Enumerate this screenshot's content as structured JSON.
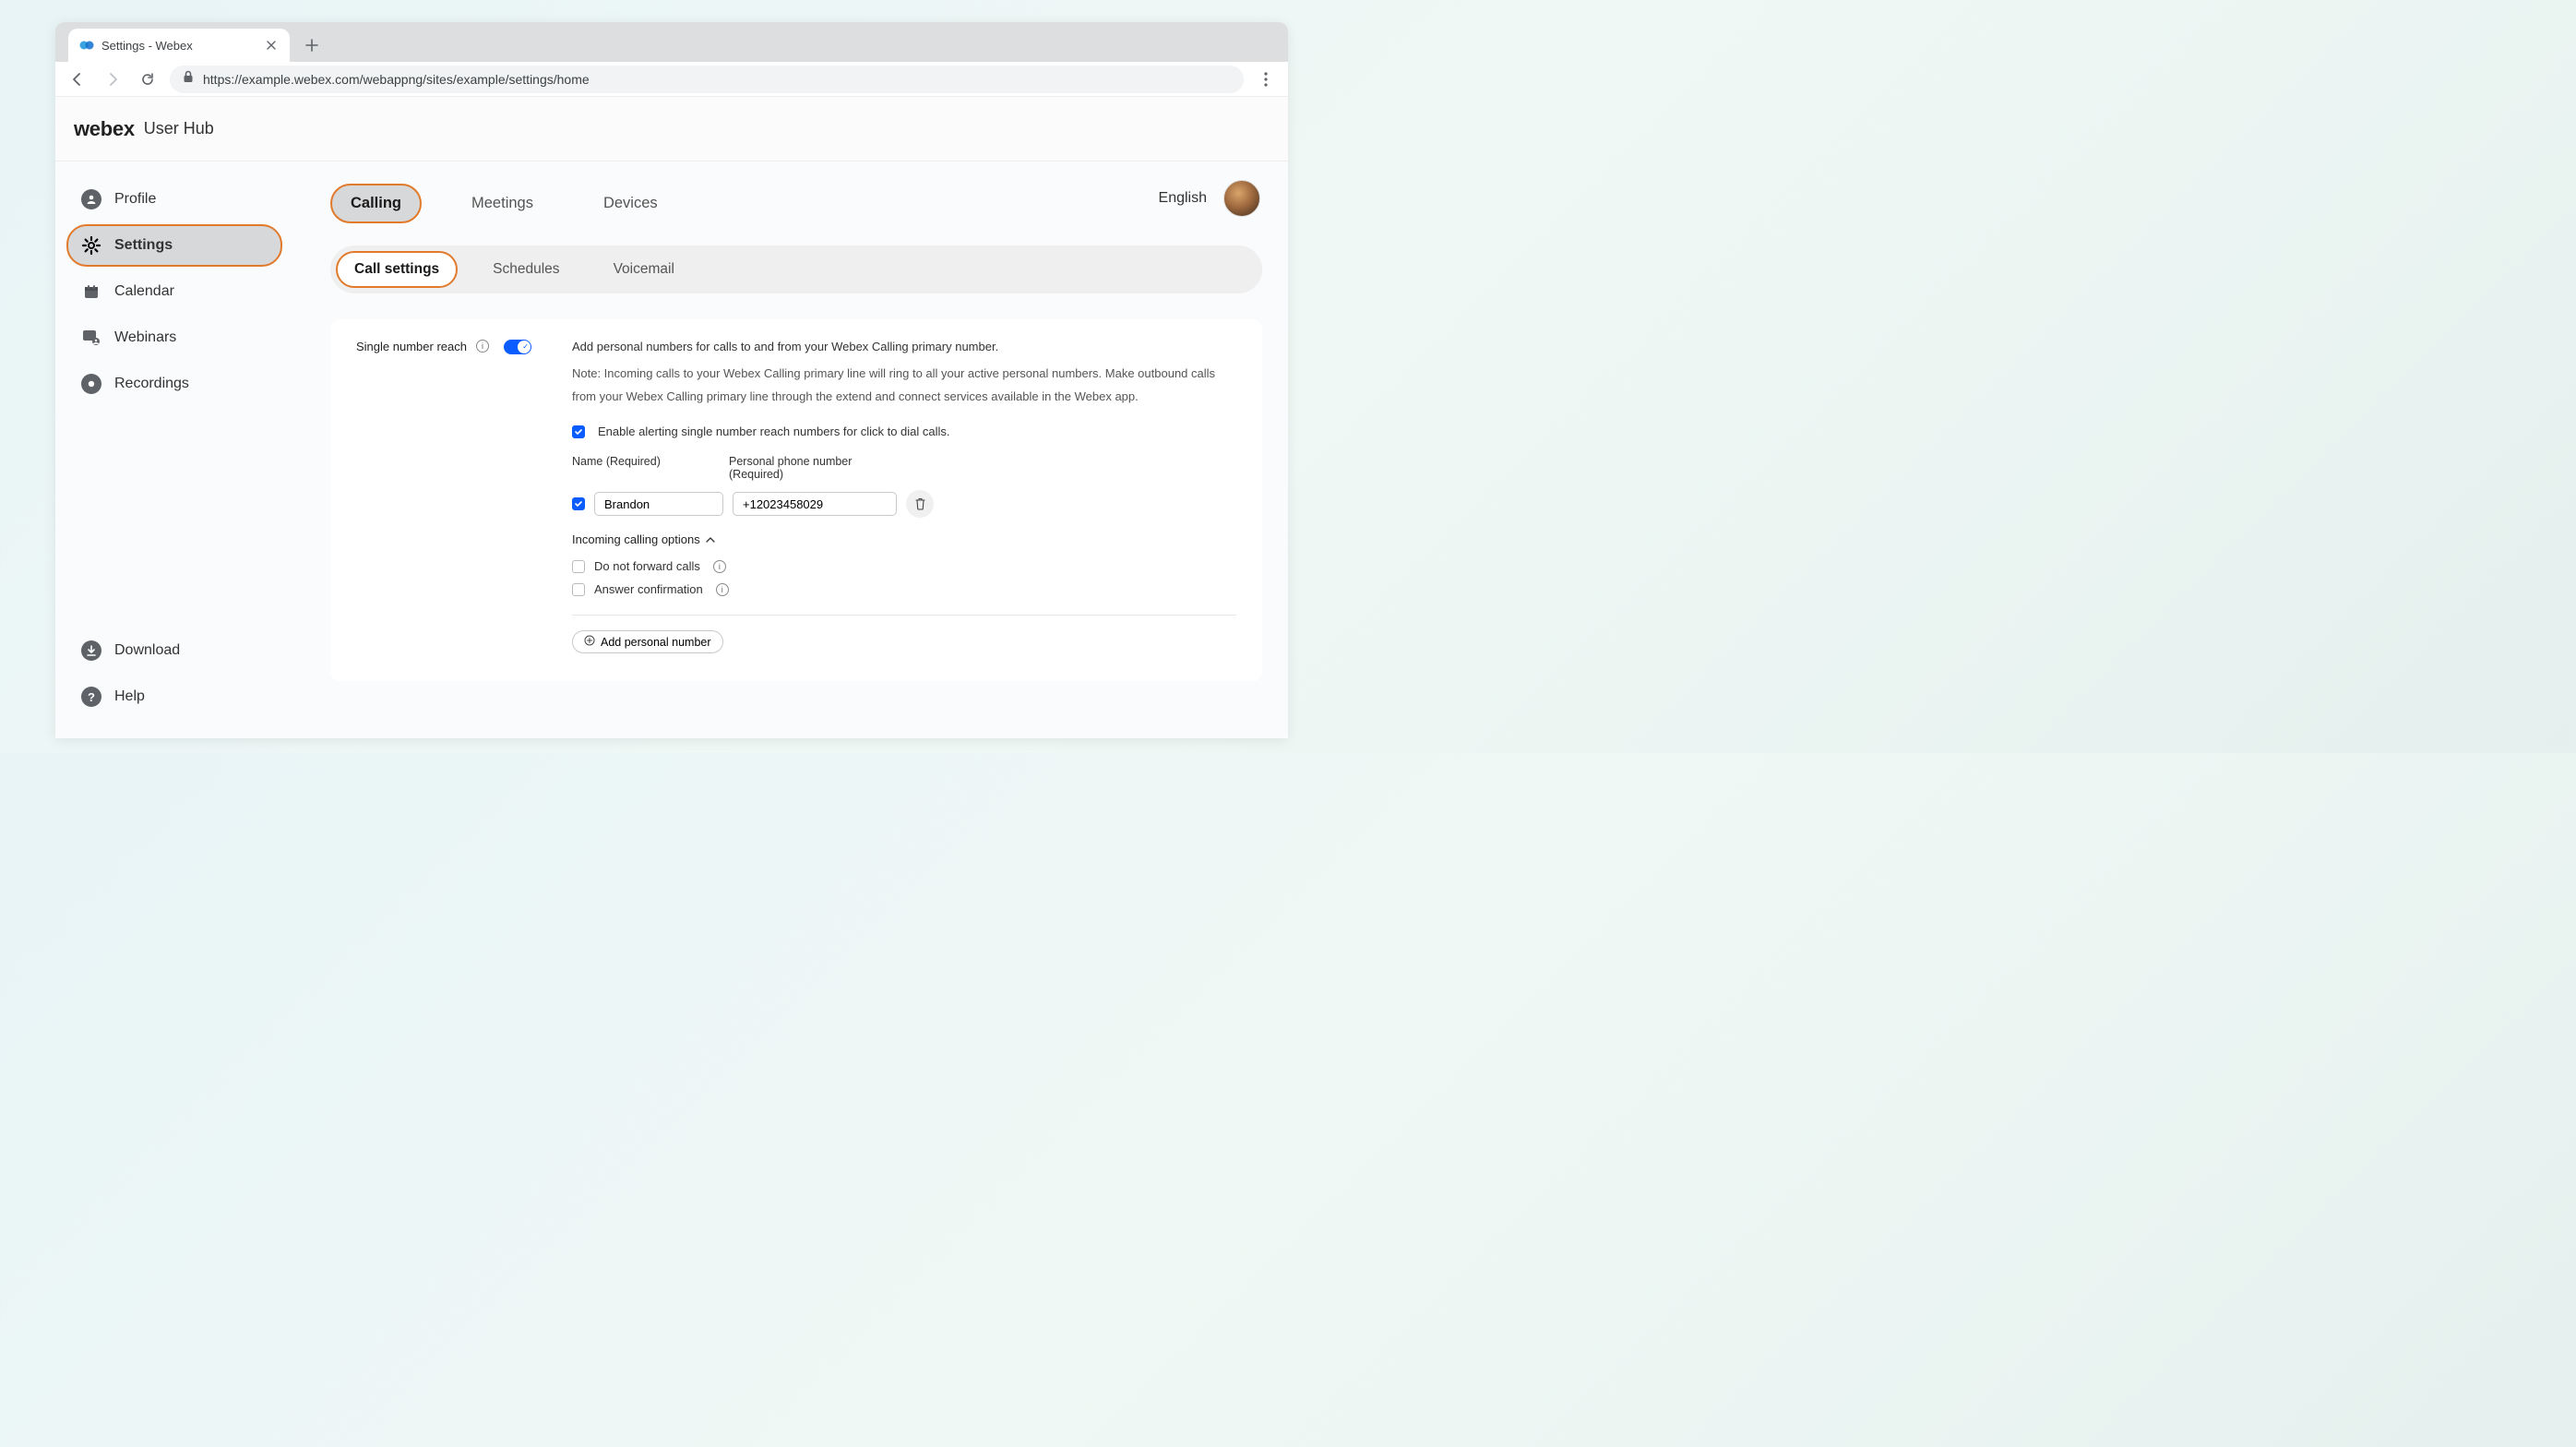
{
  "browser": {
    "tab_title": "Settings - Webex",
    "url": "https://example.webex.com/webappng/sites/example/settings/home"
  },
  "header": {
    "logo": "webex",
    "product": "User Hub"
  },
  "topright": {
    "language": "English"
  },
  "sidebar": {
    "items": [
      {
        "label": "Profile"
      },
      {
        "label": "Settings"
      },
      {
        "label": "Calendar"
      },
      {
        "label": "Webinars"
      },
      {
        "label": "Recordings"
      }
    ],
    "bottom": [
      {
        "label": "Download"
      },
      {
        "label": "Help"
      }
    ]
  },
  "tabs_primary": [
    {
      "label": "Calling"
    },
    {
      "label": "Meetings"
    },
    {
      "label": "Devices"
    }
  ],
  "tabs_secondary": [
    {
      "label": "Call settings"
    },
    {
      "label": "Schedules"
    },
    {
      "label": "Voicemail"
    }
  ],
  "snr": {
    "section_label": "Single number reach",
    "desc_bold": "Add personal numbers for calls to and from your Webex Calling primary number.",
    "desc_note": "Note: Incoming calls to your Webex Calling primary line will ring to all your active personal numbers. Make outbound calls from your Webex Calling primary line through the extend and connect services available in the Webex app.",
    "enable_alerting": "Enable alerting single number reach numbers for click to dial calls.",
    "name_label": "Name (Required)",
    "phone_label": "Personal phone number (Required)",
    "row": {
      "name": "Brandon",
      "phone": "+12023458029"
    },
    "incoming_label": "Incoming calling options",
    "opt_no_forward": "Do not forward calls",
    "opt_answer_conf": "Answer confirmation",
    "add_btn": "Add personal number"
  }
}
